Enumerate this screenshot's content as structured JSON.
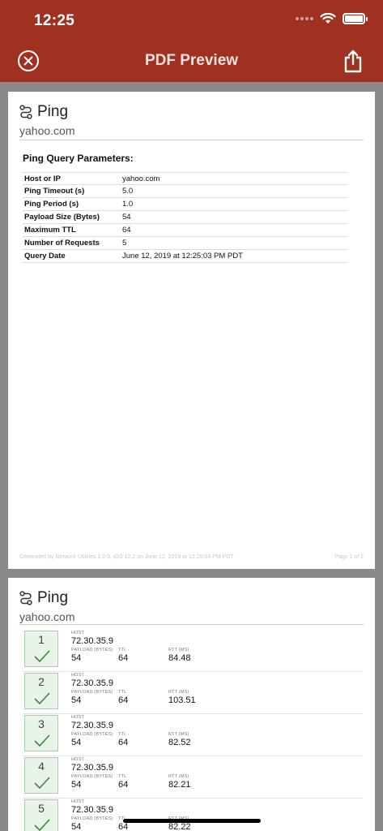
{
  "status_bar": {
    "time": "12:25"
  },
  "nav": {
    "title": "PDF Preview"
  },
  "page1": {
    "title": "Ping",
    "subtitle": "yahoo.com",
    "section_title": "Ping Query Parameters:",
    "params": [
      {
        "key": "Host or IP",
        "value": "yahoo.com"
      },
      {
        "key": "Ping Timeout (s)",
        "value": "5.0"
      },
      {
        "key": "Ping Period (s)",
        "value": "1.0"
      },
      {
        "key": "Payload Size (Bytes)",
        "value": "54"
      },
      {
        "key": "Maximum TTL",
        "value": "64"
      },
      {
        "key": "Number of Requests",
        "value": "5"
      },
      {
        "key": "Query Date",
        "value": "June 12, 2019 at 12:25:03 PM PDT"
      }
    ],
    "footer_left": "Generated by Network Utilities 1.0.9, iOS 12.2 on June 12, 2019 at 12:25:04 PM PDT",
    "footer_right": "Page 1 of 2"
  },
  "page2": {
    "title": "Ping",
    "subtitle": "yahoo.com",
    "labels": {
      "host": "HOST",
      "payload": "PAYLOAD (Bytes)",
      "ttl": "TTL",
      "rtt": "RTT (ms)"
    },
    "results": [
      {
        "num": "1",
        "host": "72.30.35.9",
        "payload": "54",
        "ttl": "64",
        "rtt": "84.48"
      },
      {
        "num": "2",
        "host": "72.30.35.9",
        "payload": "54",
        "ttl": "64",
        "rtt": "103.51"
      },
      {
        "num": "3",
        "host": "72.30.35.9",
        "payload": "54",
        "ttl": "64",
        "rtt": "82.52"
      },
      {
        "num": "4",
        "host": "72.30.35.9",
        "payload": "54",
        "ttl": "64",
        "rtt": "82.21"
      },
      {
        "num": "5",
        "host": "72.30.35.9",
        "payload": "54",
        "ttl": "64",
        "rtt": "82.22"
      }
    ]
  },
  "colors": {
    "header": "#a0301f",
    "success_border": "#a8cfa8",
    "success_fill": "#e7f4e7",
    "check": "#3a8a3a"
  },
  "icons": {
    "close": "close-circle-icon",
    "share": "share-icon",
    "ping": "route-icon",
    "success": "checkmark-icon"
  }
}
